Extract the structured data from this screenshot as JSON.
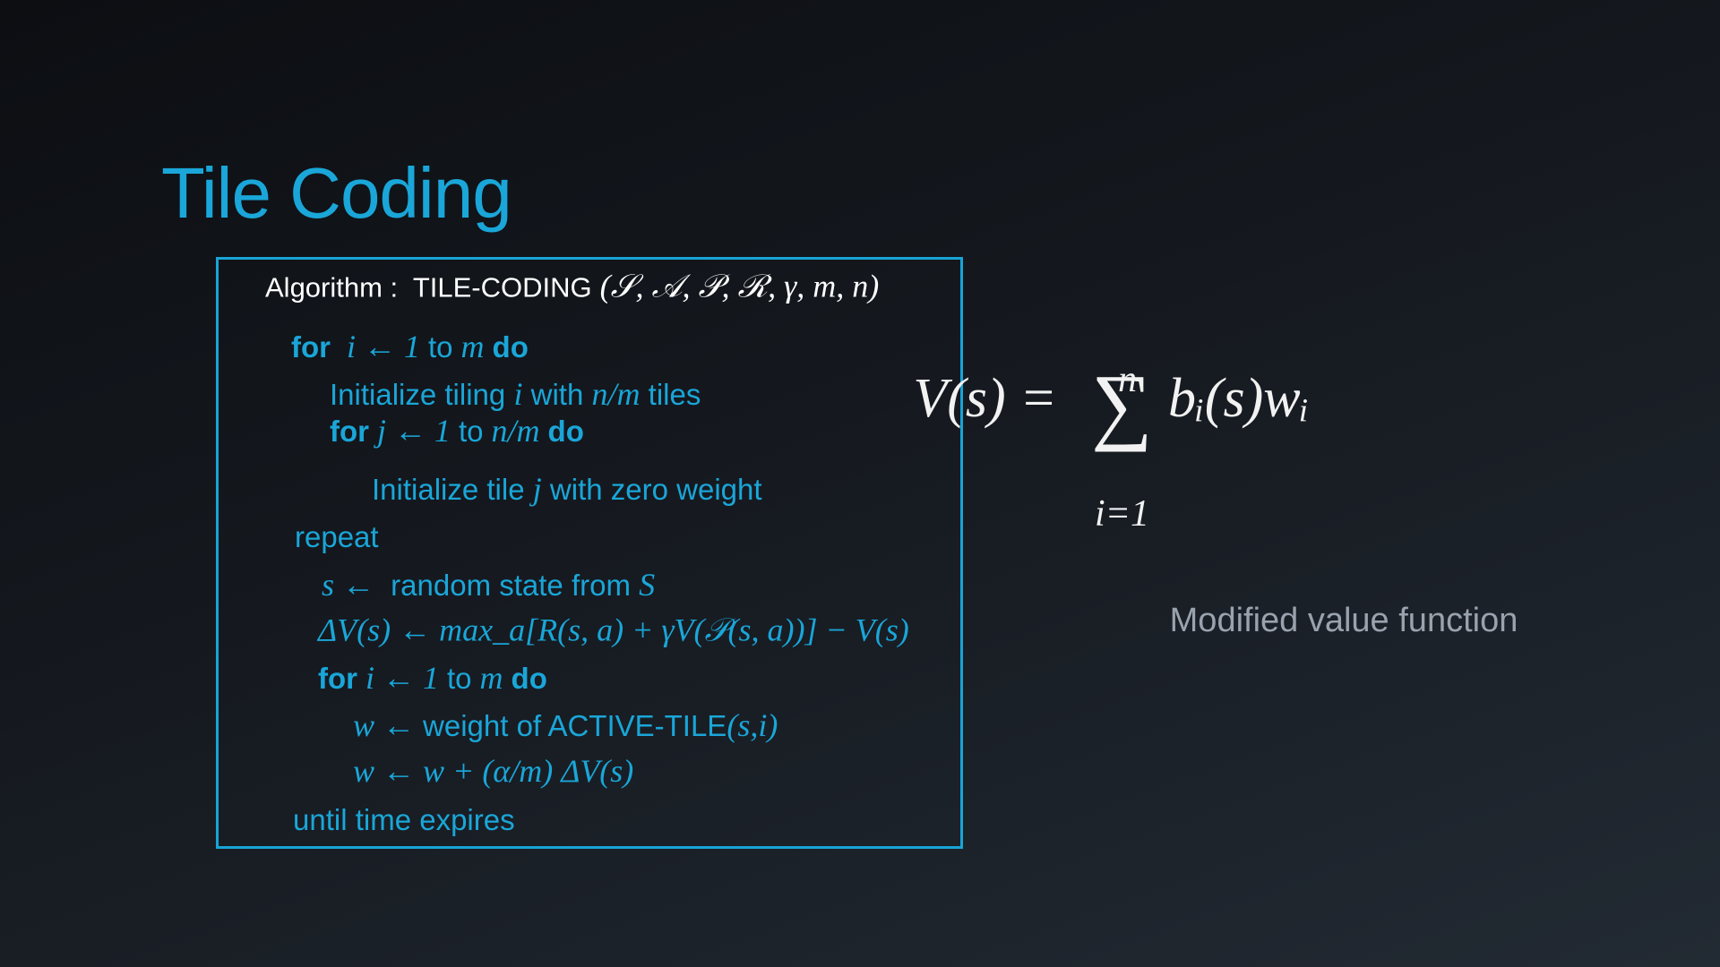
{
  "slide": {
    "title": "Tile Coding",
    "accent_color": "#1aa6d8",
    "algorithm": [
      {
        "segments": [
          {
            "t": "Algorithm :  TILE-CODING"
          },
          {
            "t": " (𝒮, 𝒜, 𝒫, ℛ, γ, m, n)",
            "m": true
          }
        ]
      },
      {
        "segments": [
          {
            "t": "for",
            "b": true
          },
          {
            "t": "  i ← 1 ",
            "m": true
          },
          {
            "t": "to"
          },
          {
            "t": " m ",
            "m": true
          },
          {
            "t": "do",
            "b": true
          }
        ]
      },
      {
        "segments": [
          {
            "t": "Initialize tiling "
          },
          {
            "t": "i",
            "m": true
          },
          {
            "t": " with "
          },
          {
            "t": "n/m",
            "m": true
          },
          {
            "t": " tiles"
          }
        ]
      },
      {
        "segments": [
          {
            "t": "for",
            "b": true
          },
          {
            "t": " j ← 1 ",
            "m": true
          },
          {
            "t": "to"
          },
          {
            "t": " n/m ",
            "m": true
          },
          {
            "t": "do",
            "b": true
          }
        ]
      },
      {
        "segments": [
          {
            "t": "Initialize tile "
          },
          {
            "t": "j",
            "m": true
          },
          {
            "t": " with zero weight"
          }
        ]
      },
      {
        "segments": [
          {
            "t": "repeat"
          }
        ]
      },
      {
        "segments": [
          {
            "t": "s ← ",
            "m": true
          },
          {
            "t": " random state from "
          },
          {
            "t": "S",
            "m": true
          }
        ]
      },
      {
        "segments": [
          {
            "t": "ΔV(s) ← max_a[R(s, a) + γV(𝒫(s, a))] − V(s)",
            "m": true
          }
        ]
      },
      {
        "segments": [
          {
            "t": "for",
            "b": true
          },
          {
            "t": " i ← 1 ",
            "m": true
          },
          {
            "t": "to"
          },
          {
            "t": " m ",
            "m": true
          },
          {
            "t": "do",
            "b": true
          }
        ]
      },
      {
        "segments": [
          {
            "t": "w ← ",
            "m": true
          },
          {
            "t": "weight of ACTIVE-TILE"
          },
          {
            "t": "(s,i)",
            "m": true
          }
        ]
      },
      {
        "segments": [
          {
            "t": "w ← w + (α/m) ΔV(s)",
            "m": true
          }
        ]
      },
      {
        "segments": [
          {
            "t": "until time expires"
          }
        ]
      }
    ],
    "formula": {
      "lhs": "V(s) =",
      "sum_top": "n",
      "sum_bottom": "i=1",
      "rhs": "bᵢ(s)wᵢ",
      "sum_symbol": "∑"
    },
    "caption": "Modified value function"
  }
}
